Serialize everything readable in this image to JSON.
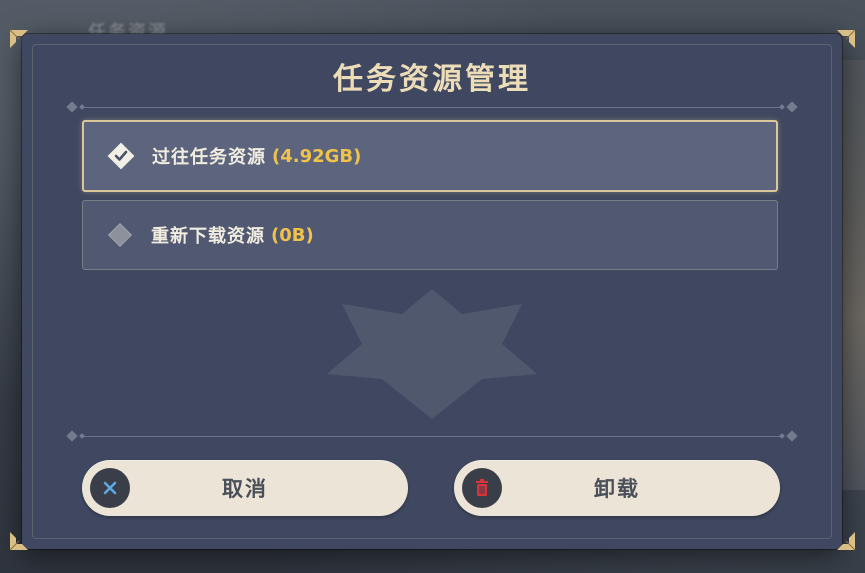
{
  "background": {
    "title": "任务资源"
  },
  "dialog": {
    "title": "任务资源管理",
    "options": [
      {
        "label": "过往任务资源",
        "size": "(4.92GB)",
        "selected": true
      },
      {
        "label": "重新下载资源",
        "size": "(0B)",
        "selected": false
      }
    ],
    "buttons": {
      "cancel_label": "取消",
      "uninstall_label": "卸载"
    }
  },
  "colors": {
    "panel": "#3f4860",
    "title": "#ecdcb8",
    "size_accent": "#f0c24a",
    "button_bg": "#ece5d7",
    "cancel_icon": "#5aa9e6",
    "uninstall_icon": "#d8343a"
  },
  "icons": {
    "cancel": "close-icon",
    "uninstall": "trash-icon",
    "checked": "checkmark-diamond-icon",
    "unchecked": "empty-diamond-icon"
  }
}
